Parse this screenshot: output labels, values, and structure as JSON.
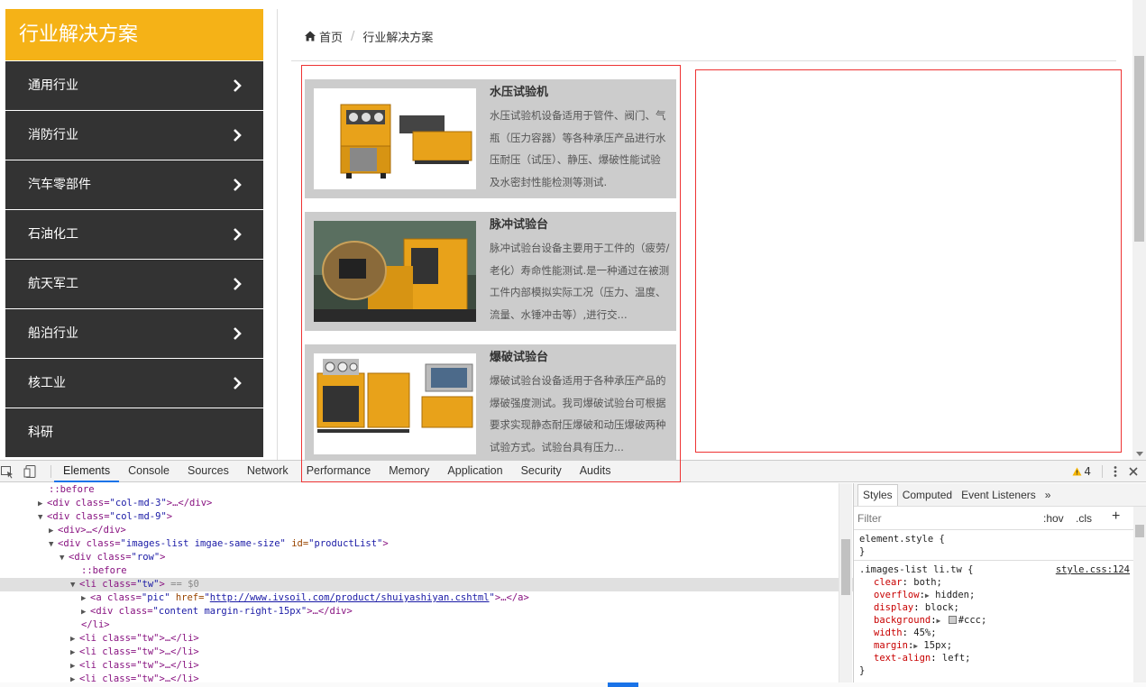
{
  "sidebar": {
    "title": "行业解决方案",
    "items": [
      {
        "label": "通用行业"
      },
      {
        "label": "消防行业"
      },
      {
        "label": "汽车零部件"
      },
      {
        "label": "石油化工"
      },
      {
        "label": "航天军工"
      },
      {
        "label": "船泊行业"
      },
      {
        "label": "核工业"
      },
      {
        "label": "科研"
      }
    ]
  },
  "breadcrumb": {
    "home": "首页",
    "separator": "/",
    "current": "行业解决方案"
  },
  "products": [
    {
      "title": "水压试验机",
      "desc": "水压试验机设备适用于管件、阀门、气瓶（压力容器）等各种承压产品进行水压耐压（试压）、静压、爆破性能试验及水密封性能检测等测试."
    },
    {
      "title": "脉冲试验台",
      "desc": "脉冲试验台设备主要用于工件的（疲劳/老化）寿命性能测试.是一种通过在被测工件内部模拟实际工况（压力、温度、流量、水锤冲击等）,进行交..."
    },
    {
      "title": "爆破试验台",
      "desc": "爆破试验台设备适用于各种承压产品的爆破强度测试。我司爆破试验台可根据要求实现静态耐压爆破和动压爆破两种试验方式。试验台具有压力..."
    }
  ],
  "devtools": {
    "tabs": [
      "Elements",
      "Console",
      "Sources",
      "Network",
      "Performance",
      "Memory",
      "Application",
      "Security",
      "Audits"
    ],
    "active_tab": "Elements",
    "warning_count": "4",
    "dom": {
      "before1": "::before",
      "col3_tag": "<div class=",
      "col3_val": "\"col-md-3\"",
      "col3_end": ">…</div>",
      "col9_tag": "<div class=",
      "col9_val": "\"col-md-9\"",
      "col9_end": ">",
      "div_line": "<div>…</div>",
      "images_tag": "<div class=",
      "images_val": "\"images-list imgae-same-size\"",
      "images_id_attr": " id=",
      "images_id_val": "\"productList\"",
      "images_end": ">",
      "row_tag": "<div class=",
      "row_val": "\"row\"",
      "row_end": ">",
      "before2": "::before",
      "li_tag": "<li class=",
      "li_val": "\"tw\"",
      "li_end": ">",
      "li_eq": " == $0",
      "a_tag": "<a class=",
      "a_val": "\"pic\"",
      "a_href_attr": " href=",
      "a_href_val": "http://www.ivsoil.com/product/shuiyashiyan.cshtml",
      "a_end": ">…</a>",
      "content_tag": "<div class=",
      "content_val": "\"content margin-right-15px\"",
      "content_end": ">…</div>",
      "li_close": "</li>",
      "li_collapsed": "<li class=\"tw\">…</li>"
    },
    "styles": {
      "tabs": [
        "Styles",
        "Computed",
        "Event Listeners"
      ],
      "more": "»",
      "filter_placeholder": "Filter",
      "hov": ":hov",
      "cls": ".cls",
      "plus": "+",
      "element_style": "element.style {",
      "close_brace": "}",
      "rule_selector": ".images-list li.tw {",
      "rule_source": "style.css:124",
      "props": [
        {
          "name": "clear",
          "value": "both;"
        },
        {
          "name": "overflow",
          "value": "hidden;"
        },
        {
          "name": "display",
          "value": "block;"
        },
        {
          "name": "background",
          "value": "#ccc;"
        },
        {
          "name": "width",
          "value": "45%;"
        },
        {
          "name": "margin",
          "value": "15px;"
        },
        {
          "name": "text-align",
          "value": "left;"
        }
      ]
    }
  },
  "colors": {
    "accent": "#f5b217",
    "sidebar_bg": "#333333",
    "card_bg": "#cccccc",
    "highlight_border": "#ee3333",
    "machine_orange": "#e8a21a"
  }
}
